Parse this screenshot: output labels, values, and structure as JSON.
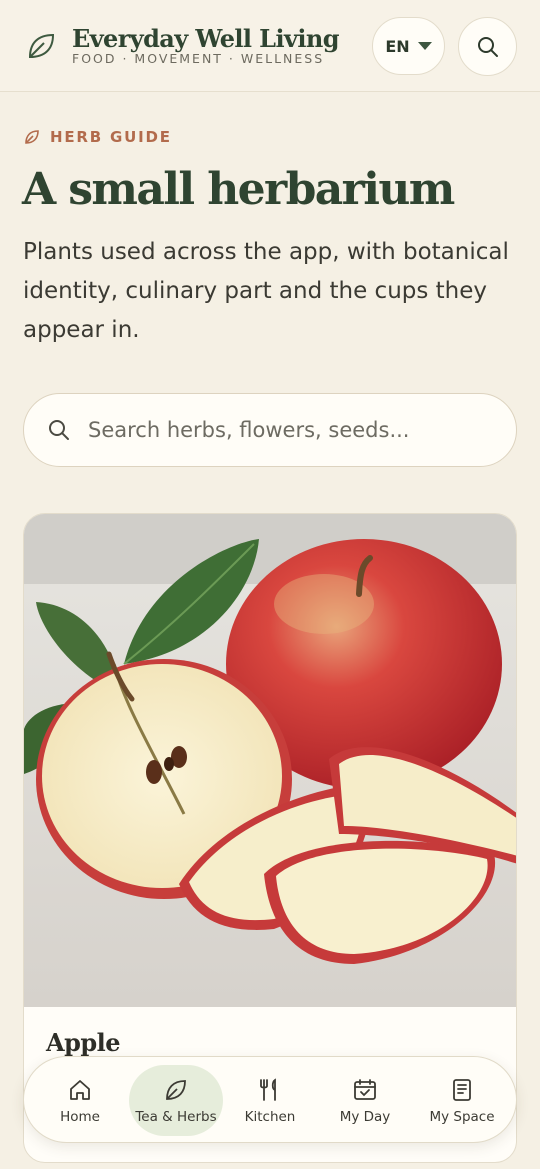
{
  "header": {
    "brand_title": "Everyday Well Living",
    "brand_tagline": "FOOD · MOVEMENT · WELLNESS",
    "lang_label": "EN"
  },
  "hero": {
    "eyebrow": "HERB GUIDE",
    "title": "A small herbarium",
    "intro": "Plants used across the app, with botanical identity, culinary part and the cups they appear in."
  },
  "search": {
    "placeholder": "Search herbs, flowers, seeds..."
  },
  "card": {
    "name": "Apple"
  },
  "nav": {
    "items": [
      {
        "label": "Home",
        "icon": "home-icon"
      },
      {
        "label": "Tea & Herbs",
        "icon": "leaf-icon",
        "active": true
      },
      {
        "label": "Kitchen",
        "icon": "utensils-icon"
      },
      {
        "label": "My Day",
        "icon": "calendar-icon"
      },
      {
        "label": "My Space",
        "icon": "notebook-icon"
      }
    ]
  },
  "colors": {
    "background": "#f5f0e4",
    "brand_green": "#2f4431",
    "accent_terracotta": "#b26b4c",
    "active_nav_bg": "#e6eddb"
  }
}
